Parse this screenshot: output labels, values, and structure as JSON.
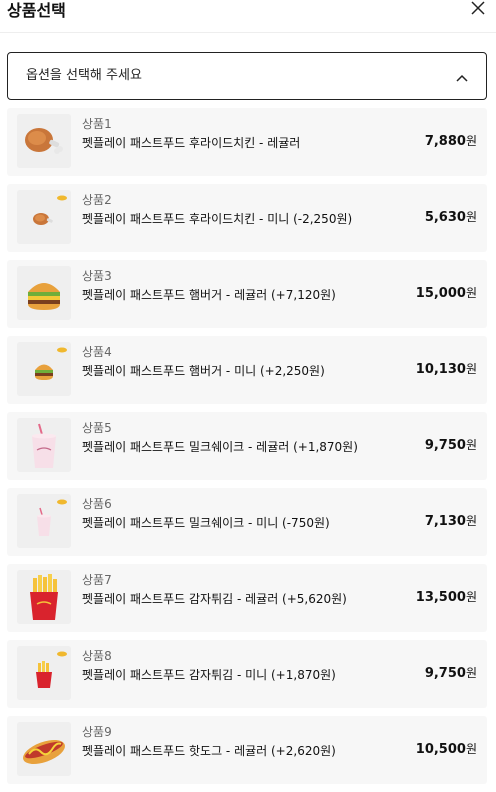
{
  "header": {
    "title": "상품선택"
  },
  "select": {
    "placeholder": "옵션을 선택해 주세요"
  },
  "items": [
    {
      "num": "상품1",
      "name": "펫플레이 패스트푸드 후라이드치킨 - 레귤러",
      "price": "7,880",
      "currency": "원",
      "icon": "fried-chicken-icon"
    },
    {
      "num": "상품2",
      "name": "펫플레이 패스트푸드 후라이드치킨 - 미니 (-2,250원)",
      "price": "5,630",
      "currency": "원",
      "icon": "fried-chicken-mini-icon"
    },
    {
      "num": "상품3",
      "name": "펫플레이 패스트푸드 햄버거 - 레귤러 (+7,120원)",
      "price": "15,000",
      "currency": "원",
      "icon": "hamburger-icon"
    },
    {
      "num": "상품4",
      "name": "펫플레이 패스트푸드 햄버거 - 미니 (+2,250원)",
      "price": "10,130",
      "currency": "원",
      "icon": "hamburger-mini-icon"
    },
    {
      "num": "상품5",
      "name": "펫플레이 패스트푸드 밀크쉐이크 - 레귤러 (+1,870원)",
      "price": "9,750",
      "currency": "원",
      "icon": "milkshake-icon"
    },
    {
      "num": "상품6",
      "name": "펫플레이 패스트푸드 밀크쉐이크 - 미니 (-750원)",
      "price": "7,130",
      "currency": "원",
      "icon": "milkshake-mini-icon"
    },
    {
      "num": "상품7",
      "name": "펫플레이 패스트푸드 감자튀김 - 레귤러 (+5,620원)",
      "price": "13,500",
      "currency": "원",
      "icon": "french-fries-icon"
    },
    {
      "num": "상품8",
      "name": "펫플레이 패스트푸드 감자튀김 - 미니 (+1,870원)",
      "price": "9,750",
      "currency": "원",
      "icon": "french-fries-mini-icon"
    },
    {
      "num": "상품9",
      "name": "펫플레이 패스트푸드 핫도그 - 레귤러 (+2,620원)",
      "price": "10,500",
      "currency": "원",
      "icon": "hotdog-icon"
    }
  ]
}
